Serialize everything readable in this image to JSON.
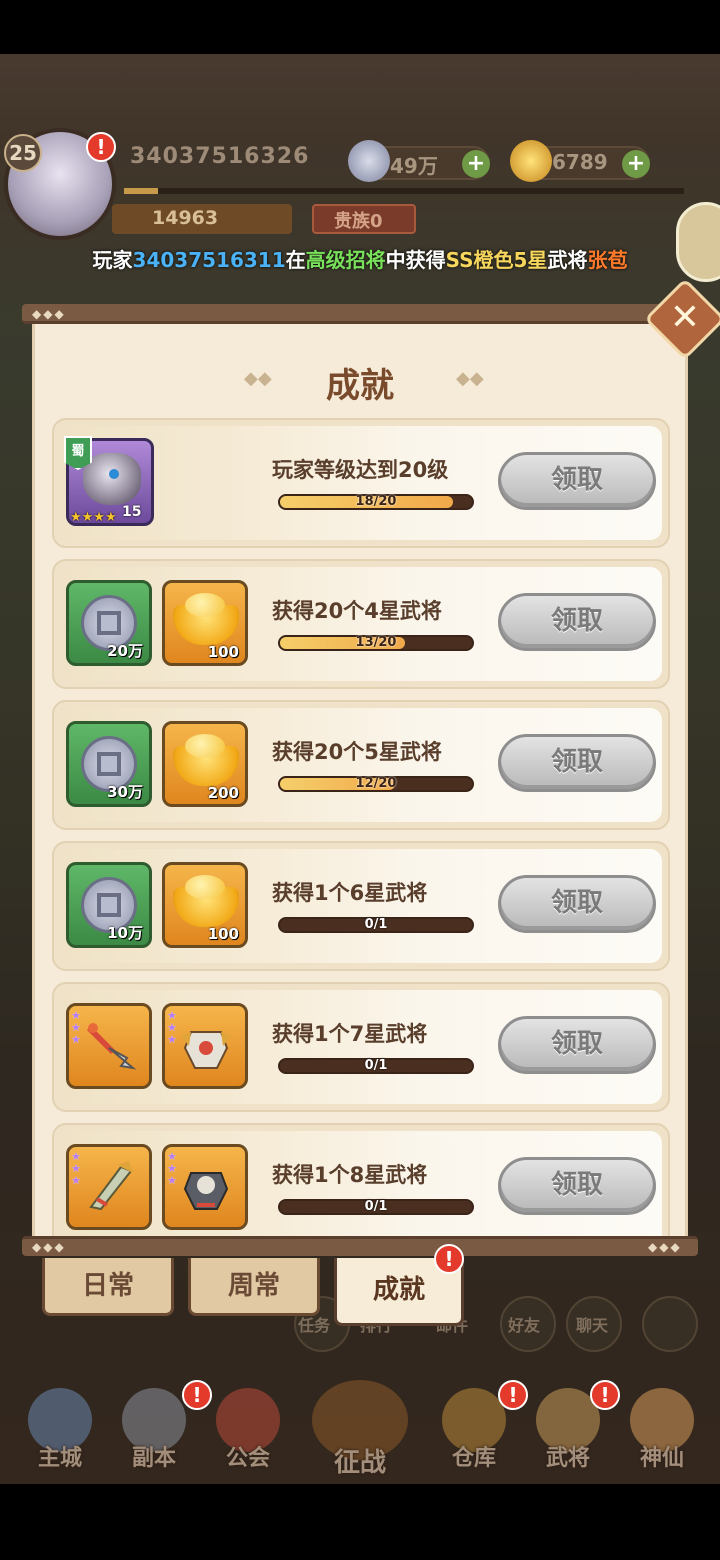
{
  "hud": {
    "level": "25",
    "player_id": "34037516326",
    "coins": "49万",
    "gold": "6789",
    "paw_points": "14963",
    "noble": "贵族0",
    "alert_mark": "!"
  },
  "ticker": {
    "prefix": "玩家",
    "player": "34037516311",
    "at": "在",
    "event": "高级招将",
    "mid": "中获得",
    "rarity": "SS橙色5星",
    "noun": "武将",
    "hero": "张苞"
  },
  "panel": {
    "title": "成就",
    "close_label": "✕"
  },
  "achievements": [
    {
      "task": "玩家等级达到20级",
      "progress": "18/20",
      "ratio": 0.9,
      "button": "领取",
      "rewards": [
        {
          "type": "hero",
          "faction": "蜀",
          "stars": "★★★★",
          "level": "15"
        }
      ]
    },
    {
      "task": "获得20个4星武将",
      "progress": "13/20",
      "ratio": 0.65,
      "button": "领取",
      "rewards": [
        {
          "type": "coin",
          "qty": "20万"
        },
        {
          "type": "ingot",
          "qty": "100"
        }
      ]
    },
    {
      "task": "获得20个5星武将",
      "progress": "12/20",
      "ratio": 0.6,
      "button": "领取",
      "rewards": [
        {
          "type": "coin",
          "qty": "30万"
        },
        {
          "type": "ingot",
          "qty": "200"
        }
      ]
    },
    {
      "task": "获得1个6星武将",
      "progress": "0/1",
      "ratio": 0,
      "button": "领取",
      "rewards": [
        {
          "type": "coin",
          "qty": "10万"
        },
        {
          "type": "ingot",
          "qty": "100"
        }
      ]
    },
    {
      "task": "获得1个7星武将",
      "progress": "0/1",
      "ratio": 0,
      "button": "领取",
      "rewards": [
        {
          "type": "weapon"
        },
        {
          "type": "armor"
        }
      ]
    },
    {
      "task": "获得1个8星武将",
      "progress": "0/1",
      "ratio": 0,
      "button": "领取",
      "rewards": [
        {
          "type": "sword"
        },
        {
          "type": "armor"
        }
      ]
    }
  ],
  "tabs": [
    {
      "label": "日常",
      "active": false
    },
    {
      "label": "周常",
      "active": false
    },
    {
      "label": "成就",
      "active": true
    }
  ],
  "mid_row": [
    "任务",
    "排行",
    "邮件",
    "好友",
    "聊天"
  ],
  "nav": [
    {
      "label": "主城"
    },
    {
      "label": "副本"
    },
    {
      "label": "公会"
    },
    {
      "label": "征战"
    },
    {
      "label": "仓库"
    },
    {
      "label": "武将"
    },
    {
      "label": "神仙"
    }
  ],
  "colors": {
    "panel_bg": "#f5ebd8",
    "title": "#7a4a2c",
    "progress_fill": "#f1a94a",
    "claim_disabled": "#b8b8b8",
    "alert": "#e43a2c"
  }
}
